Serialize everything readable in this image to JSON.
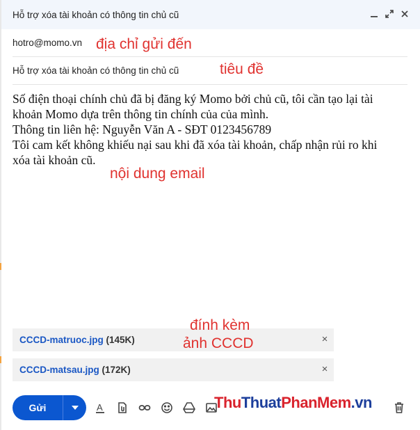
{
  "window": {
    "title": "Hỗ trợ xóa tài khoản có thông tin chủ cũ"
  },
  "compose": {
    "to": "hotro@momo.vn",
    "subject": "Hỗ trợ xóa tài khoản có thông tin chủ cũ",
    "body_lines": [
      "Số điện thoại chính chủ đã bị đăng ký Momo bởi chủ cũ, tôi cần tạo lại tài",
      "khoản Momo dựa trên thông tin chính của của mình.",
      "Thông tin liên hệ: Nguyễn Văn A - SĐT 0123456789",
      "Tôi cam kết không khiếu nại sau khi đã xóa tài khoản, chấp nhận rủi ro khi",
      "xóa tài khoản cũ."
    ]
  },
  "annotations": {
    "to": "địa chỉ gửi đến",
    "subject": "tiêu đề",
    "body": "nội dung email",
    "attach_line1": "đính kèm",
    "attach_line2": "ảnh CCCD"
  },
  "attachments": [
    {
      "name": "CCCD-matruoc.jpg",
      "size": "(145K)"
    },
    {
      "name": "CCCD-matsau.jpg",
      "size": "(172K)"
    }
  ],
  "toolbar": {
    "send_label": "Gửi",
    "icons": [
      "format-text-icon",
      "attach-file-icon",
      "insert-link-icon",
      "emoji-icon",
      "drive-icon",
      "insert-photo-icon",
      "discard-icon"
    ]
  },
  "watermark": {
    "part1": "Thu",
    "part2": "Thuat",
    "part3": "PhanMem",
    "part4": ".vn"
  },
  "colors": {
    "accent": "#0b57d0",
    "annotation": "#e0322f",
    "attachment_link": "#1a57c4",
    "titlebar": "#f2f6fc"
  }
}
